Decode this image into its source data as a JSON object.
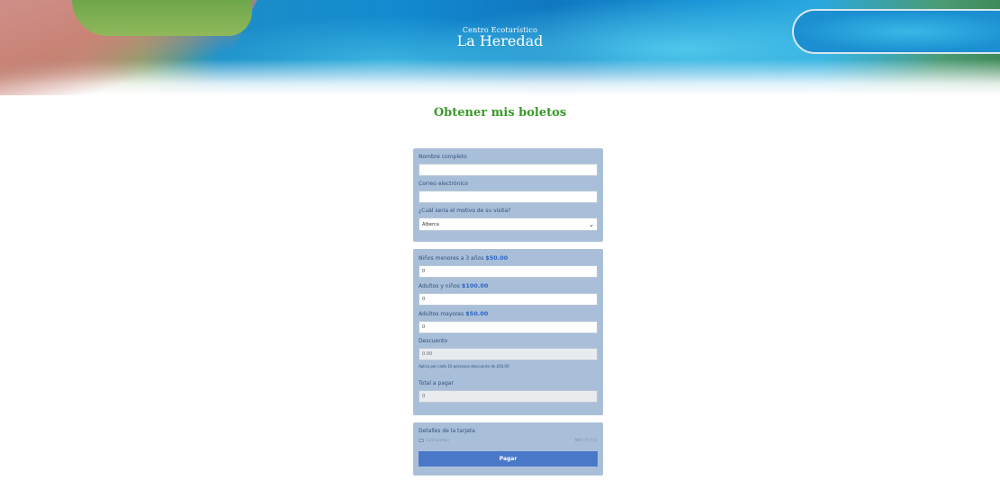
{
  "header": {
    "subtitle": "Centro Ecoturístico",
    "title": "La Heredad"
  },
  "page": {
    "title": "Obtener mis boletos"
  },
  "visitor": {
    "name_label": "Nombre completo",
    "name_value": "",
    "email_label": "Correo electrónico",
    "email_value": "",
    "reason_label": "¿Cuál sería el motivo de su visita?",
    "reason_selected": "Alberca"
  },
  "tickets": {
    "children_label": "Niños menores a 3 años",
    "children_price": "$50.00",
    "children_value": "0",
    "adults_label": "Adultos y niños",
    "adults_price": "$100.00",
    "adults_value": "0",
    "seniors_label": "Adultos mayores",
    "seniors_price": "$50.00",
    "seniors_value": "0",
    "discount_label": "Descuento",
    "discount_value": "0.00",
    "discount_note": "Aplica por cada 10 personas descuento de $50.00",
    "total_label": "Total a pagar",
    "total_value": "0"
  },
  "payment": {
    "card_label": "Detalles de la tarjeta",
    "card_number_placeholder": "Card number",
    "card_expiry_placeholder": "MM / YY  CVC",
    "pay_button": "Pagar"
  },
  "colors": {
    "title_green": "#3a9a2a",
    "card_bg": "#a9bfd9",
    "price_blue": "#2b66c4",
    "button_blue": "#4a78c8"
  }
}
